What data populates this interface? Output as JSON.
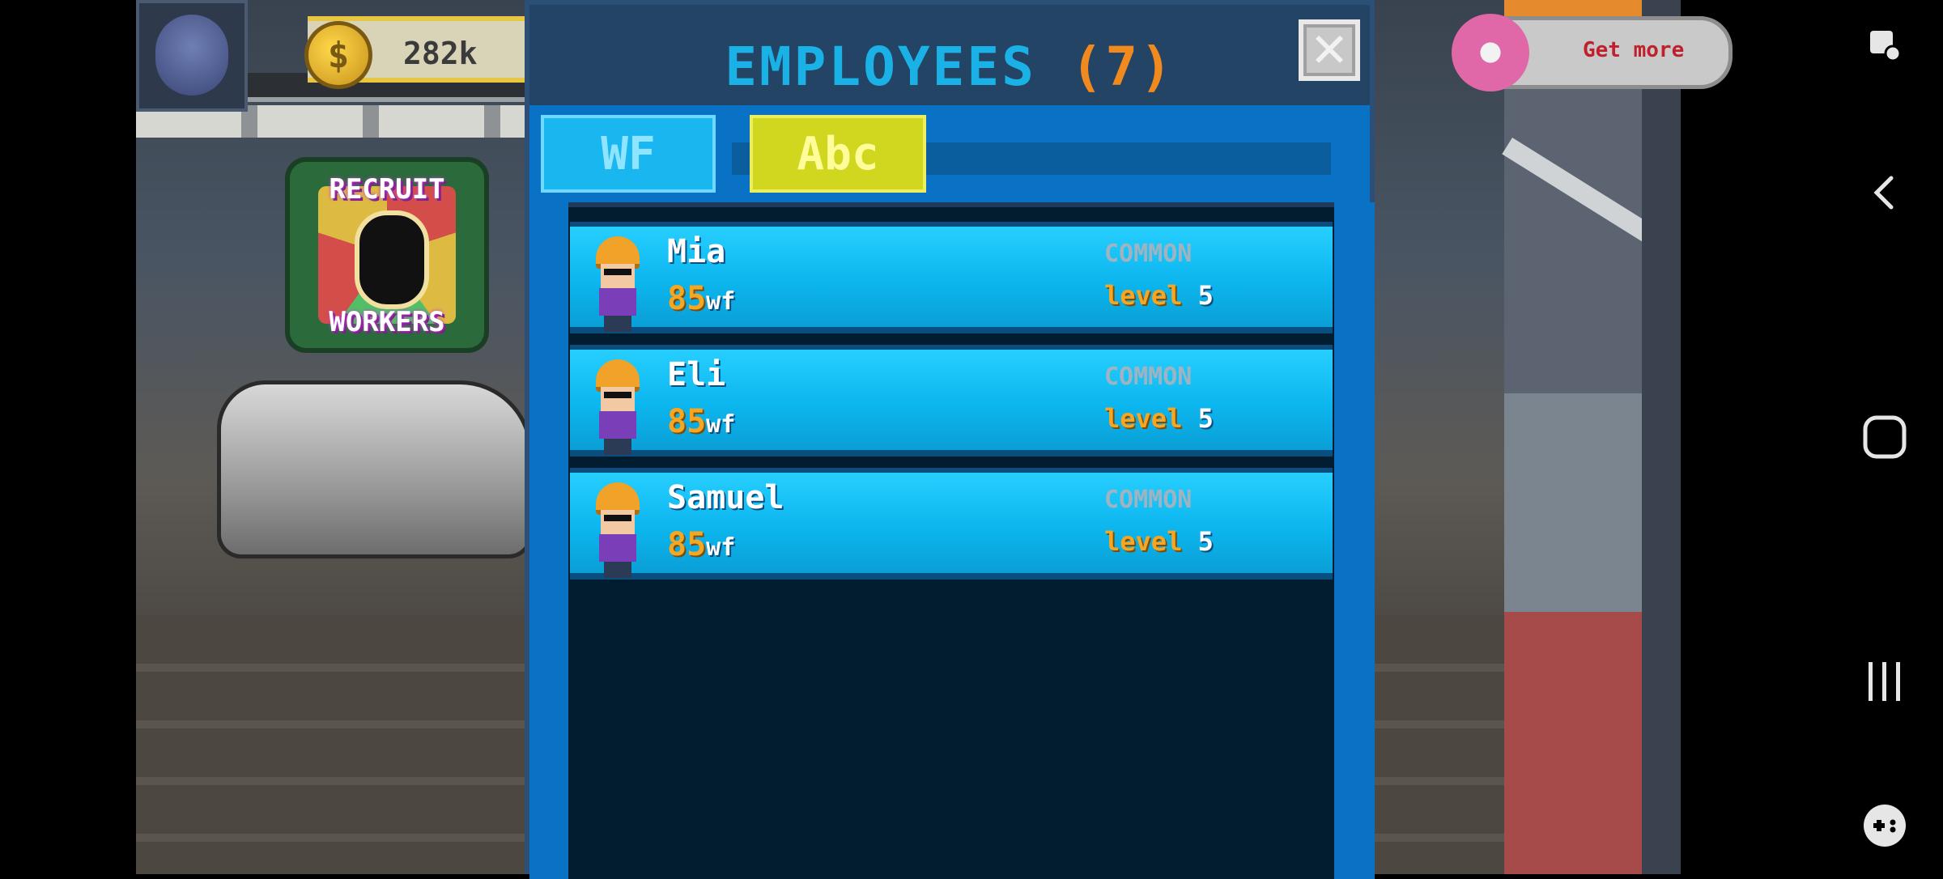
{
  "hud": {
    "coins": "282k",
    "coin_symbol": "$",
    "get_more_label": "Get more"
  },
  "recruit": {
    "top_label": "RECRUIT",
    "bottom_label": "WORKERS"
  },
  "modal": {
    "title": "EMPLOYEES",
    "count": "(7)",
    "close_symbol": "✕",
    "tabs": [
      {
        "label": "WF",
        "selected": true
      },
      {
        "label": "Abc",
        "selected": false
      }
    ],
    "employees": [
      {
        "name": "Mia",
        "wf": "85",
        "wf_unit": "wf",
        "rarity": "COMMON",
        "level_label": "level",
        "level": "5"
      },
      {
        "name": "Eli",
        "wf": "85",
        "wf_unit": "wf",
        "rarity": "COMMON",
        "level_label": "level",
        "level": "5"
      },
      {
        "name": "Samuel",
        "wf": "85",
        "wf_unit": "wf",
        "rarity": "COMMON",
        "level_label": "level",
        "level": "5"
      }
    ]
  },
  "colors": {
    "title": "#1ab2e6",
    "count": "#f08a1e",
    "row": "#0cb6ee",
    "tab_wf": "#19b6ef",
    "tab_abc": "#d1d61e"
  },
  "system_nav": {
    "icons": [
      "screenshot-icon",
      "back-icon",
      "home-icon",
      "recents-icon",
      "game-launcher-icon"
    ]
  }
}
